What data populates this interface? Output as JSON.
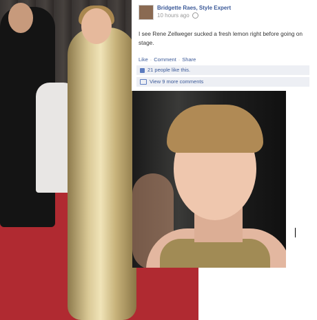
{
  "post": {
    "author": "Bridgette Raes, Style Expert",
    "time": "10 hours ago",
    "message": "I see Rene Zellweger sucked a fresh lemon right before going on stage.",
    "actions": {
      "like": "Like",
      "comment": "Comment",
      "share": "Share",
      "separator": "·"
    },
    "likes_text": "21 people like this.",
    "comments_text": "View 9 more comments"
  },
  "icons": {
    "privacy": "globe-icon",
    "likes": "thumbs-up-icon",
    "comments": "comment-bubble-icon"
  },
  "colors": {
    "link": "#3b5998",
    "meta": "#999999",
    "text": "#333333",
    "summary_bg": "#edeff4",
    "carpet": "#b02a31"
  }
}
